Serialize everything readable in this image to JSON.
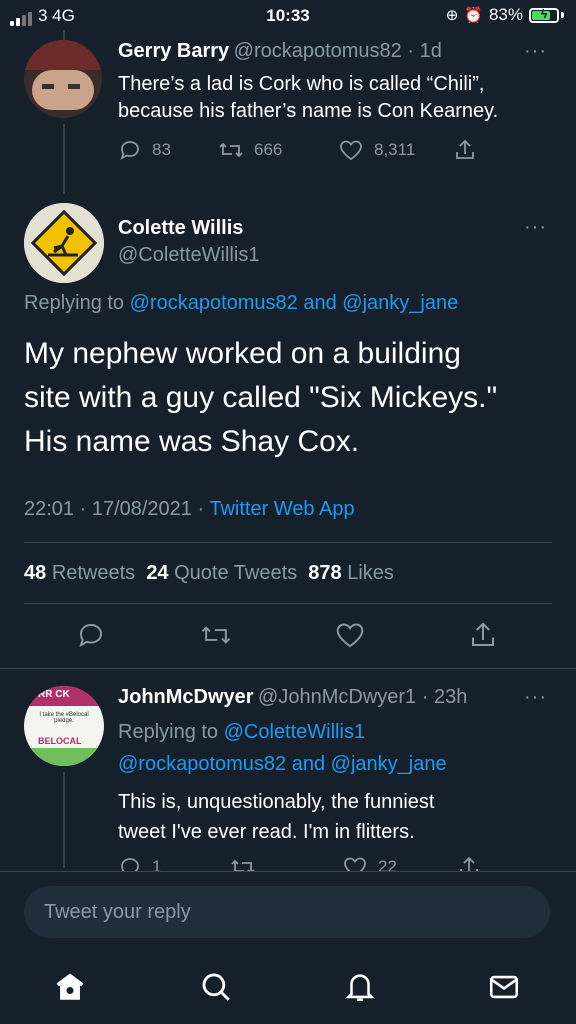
{
  "status_bar": {
    "carrier": "3  4G",
    "time": "10:33",
    "battery": "83%",
    "battery_level": 0.83
  },
  "parent_tweet": {
    "name": "Gerry Barry",
    "handle": "@rockapotomus82 · 1d",
    "line1": "There’s a lad is Cork who is called “Chili”,",
    "line2": "because his father’s name is Con Kearney.",
    "replies": "83",
    "retweets": "666",
    "likes": "8,311",
    "more": "···"
  },
  "main_tweet": {
    "name": "Colette Willis",
    "handle": "@ColetteWillis1",
    "more": "···",
    "replying_prefix": "Replying to",
    "replying_user1": "@rockapotomus82",
    "replying_and": "and",
    "replying_user2": "@janky_jane",
    "line1": "My nephew worked on a building",
    "line2": "site with a guy called \"Six Mickeys.\"",
    "line3": "His name was Shay Cox.",
    "timestamp": "22:01 · 17/08/2021 · ",
    "source": "Twitter Web App",
    "retweets_count": "48",
    "retweets_label": "Retweets",
    "quotes_count": "24",
    "quotes_label": "Quote Tweets",
    "likes_count": "878",
    "likes_label": "Likes"
  },
  "reply_tweet": {
    "name": "JohnMcDwyer",
    "handle": "@JohnMcDwyer1 · 23h",
    "more": "···",
    "replying_prefix": "Replying to",
    "replying_user1": "@ColetteWillis1",
    "replying_user2": "@rockapotomus82",
    "replying_and": "and",
    "replying_user3": "@janky_jane",
    "line1": "This is, unquestionably,  the funniest",
    "line2": "tweet I've ever read. I'm in flitters.",
    "replies": "1",
    "likes": "22",
    "avatar_top": "RR CK",
    "avatar_mid": "I take the #Belocal pledge.",
    "avatar_logo": "BELOCAL"
  },
  "composer": {
    "placeholder": "Tweet your reply"
  },
  "colors": {
    "background": "#15202b",
    "accent": "#1d9bf0",
    "muted": "#8899a6",
    "divider": "#38444d"
  },
  "icons": [
    "reply-icon",
    "retweet-icon",
    "like-icon",
    "share-icon",
    "home-icon",
    "search-icon",
    "notifications-icon",
    "messages-icon"
  ]
}
